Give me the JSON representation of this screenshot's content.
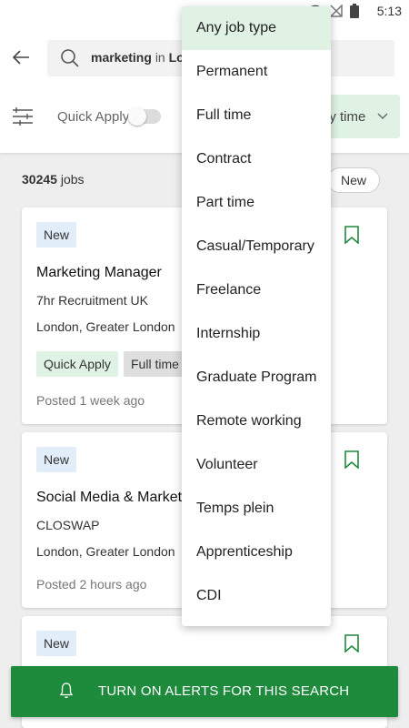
{
  "status_bar": {
    "time": "5:13",
    "icons": [
      "wifi-icon",
      "no-signal-icon",
      "battery-icon"
    ]
  },
  "search": {
    "keyword": "marketing",
    "connector": "in",
    "location": "Lo"
  },
  "filters": {
    "quick_apply_label": "Quick Apply",
    "quick_apply_enabled": false,
    "job_type_chip": "ny time"
  },
  "results": {
    "count": "30245",
    "count_suffix": "jobs",
    "sort_chip": "New"
  },
  "job_type_dropdown": {
    "selected_index": 0,
    "options": [
      "Any job type",
      "Permanent",
      "Full time",
      "Contract",
      "Part time",
      "Casual/Temporary",
      "Freelance",
      "Internship",
      "Graduate Program",
      "Remote working",
      "Volunteer",
      "Temps plein",
      "Apprenticeship",
      "CDI"
    ]
  },
  "jobs": [
    {
      "badge": "New",
      "title": "Marketing Manager",
      "company": "7hr Recruitment UK",
      "location": "London, Greater London",
      "tags": [
        "Quick Apply",
        "Full time"
      ],
      "posted": "Posted 1 week ago"
    },
    {
      "badge": "New",
      "title": "Social Media & Market",
      "company": "CLOSWAP",
      "location": "London, Greater London",
      "tags": [],
      "posted": "Posted 2 hours ago"
    },
    {
      "badge": "New"
    }
  ],
  "alert_button": {
    "label": "TURN ON ALERTS FOR THIS SEARCH"
  },
  "colors": {
    "brand_green": "#1e8a3c",
    "selected_green": "#dff2e4",
    "badge_blue": "#e1edf9"
  }
}
